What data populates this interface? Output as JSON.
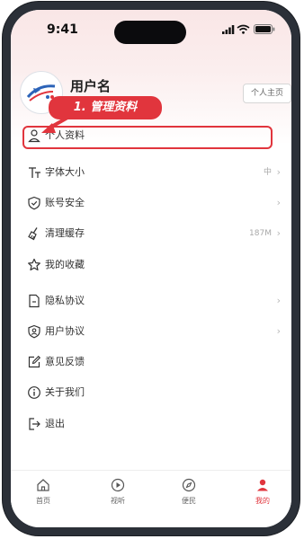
{
  "status": {
    "time": "9:41"
  },
  "profile": {
    "username": "用户名",
    "home_button": "个人主页"
  },
  "menu": [
    {
      "label": "个人资料",
      "value": "",
      "chevron": false
    },
    {
      "label": "字体大小",
      "value": "中",
      "chevron": true
    },
    {
      "label": "账号安全",
      "value": "",
      "chevron": true
    },
    {
      "label": "清理缓存",
      "value": "187M",
      "chevron": true
    },
    {
      "label": "我的收藏",
      "value": "",
      "chevron": false
    },
    {
      "label": "隐私协议",
      "value": "",
      "chevron": true
    },
    {
      "label": "用户协议",
      "value": "",
      "chevron": true
    },
    {
      "label": "意见反馈",
      "value": "",
      "chevron": false
    },
    {
      "label": "关于我们",
      "value": "",
      "chevron": false
    },
    {
      "label": "退出",
      "value": "",
      "chevron": false
    }
  ],
  "annotation": {
    "text": "1. 管理资料"
  },
  "tabs": [
    {
      "label": "首页",
      "icon": "home-icon",
      "active": false
    },
    {
      "label": "视听",
      "icon": "play-icon",
      "active": false
    },
    {
      "label": "便民",
      "icon": "compass-icon",
      "active": false
    },
    {
      "label": "我的",
      "icon": "person-icon",
      "active": true
    }
  ],
  "colors": {
    "accent": "#e1353d",
    "tint": "#f9e6e6"
  },
  "chevron_glyph": "›"
}
